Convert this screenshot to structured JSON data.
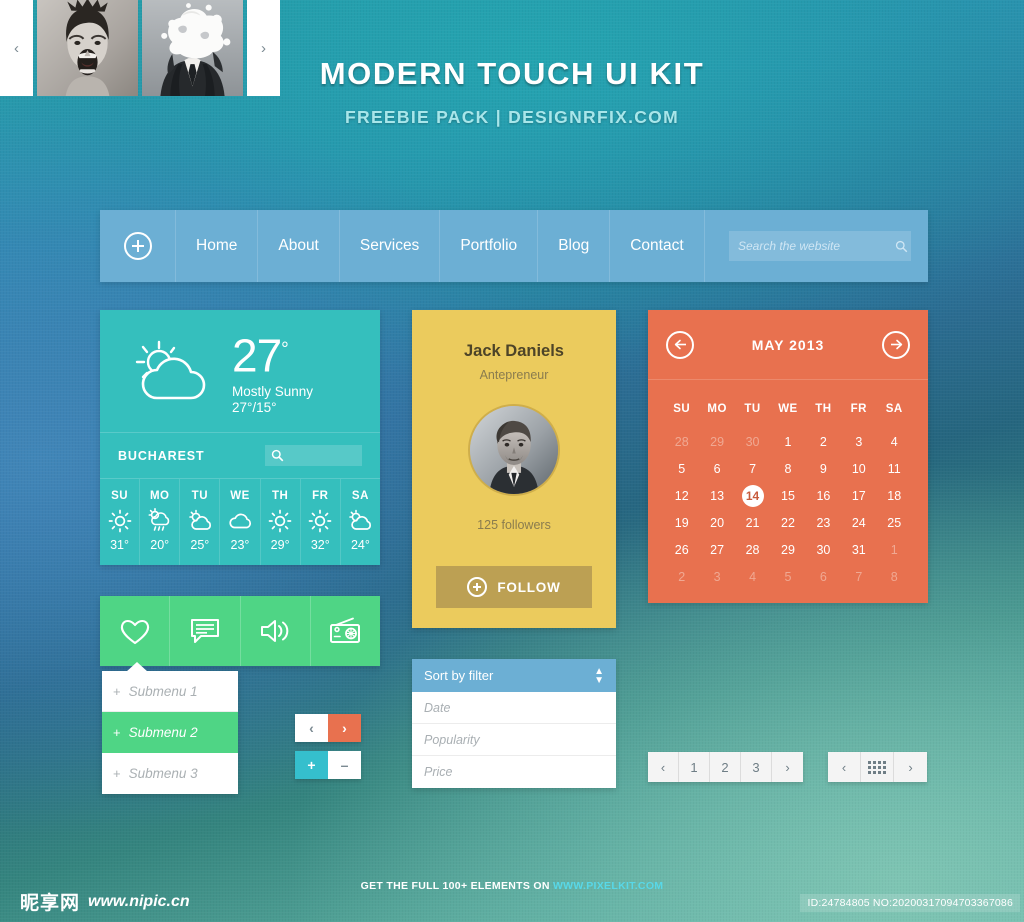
{
  "header": {
    "title": "MODERN TOUCH UI KIT",
    "subtitle": "FREEBIE PACK  |  DESIGNRFIX.COM"
  },
  "nav": {
    "items": [
      {
        "label": "Home"
      },
      {
        "label": "About"
      },
      {
        "label": "Services"
      },
      {
        "label": "Portfolio"
      },
      {
        "label": "Blog"
      },
      {
        "label": "Contact"
      }
    ],
    "search_placeholder": "Search the website",
    "search_value": "",
    "plus_icon": "plus-circle-icon",
    "search_icon": "search-icon",
    "bg_color": "#6cafd4"
  },
  "weather": {
    "temperature": "27",
    "degree": "°",
    "condition": "Mostly Sunny",
    "range": "27°/15°",
    "city": "BUCHAREST",
    "city_search_icon": "search-icon",
    "main_icon": "sun-behind-cloud-icon",
    "bg_color": "#35bfbd",
    "days": [
      {
        "day": "SU",
        "icon": "sun-icon",
        "temp": "31°"
      },
      {
        "day": "MO",
        "icon": "rain-cloud-icon",
        "temp": "20°"
      },
      {
        "day": "TU",
        "icon": "sun-behind-cloud-icon",
        "temp": "25°"
      },
      {
        "day": "WE",
        "icon": "cloud-icon",
        "temp": "23°"
      },
      {
        "day": "TH",
        "icon": "sun-icon",
        "temp": "29°"
      },
      {
        "day": "FR",
        "icon": "sun-icon",
        "temp": "32°"
      },
      {
        "day": "SA",
        "icon": "sun-behind-cloud-icon",
        "temp": "24°"
      }
    ]
  },
  "iconbar": {
    "bg_color": "#4fd585",
    "icons": [
      {
        "name": "heart-icon"
      },
      {
        "name": "chat-bubble-icon"
      },
      {
        "name": "speaker-icon"
      },
      {
        "name": "radio-icon"
      }
    ]
  },
  "submenu": {
    "items": [
      {
        "plus": "+",
        "label": "Submenu 1",
        "active": false
      },
      {
        "plus": "+",
        "label": "Submenu 2",
        "active": true
      },
      {
        "plus": "+",
        "label": "Submenu 3",
        "active": false
      }
    ]
  },
  "arrow_buttons": {
    "prev": "‹",
    "next": "›"
  },
  "stepper_buttons": {
    "plus": "+",
    "minus": "–"
  },
  "profile": {
    "name": "Jack Daniels",
    "role": "Antepreneur",
    "followers": "125 followers",
    "follow_label": "FOLLOW",
    "follow_icon": "plus-circle-icon",
    "avatar_icon": "avatar-photo",
    "bg_color": "#ebcb5d",
    "button_color": "#bca053"
  },
  "sort": {
    "header_label": "Sort by filter",
    "caret_icon": "updown-caret-icon",
    "options": [
      {
        "label": "Date"
      },
      {
        "label": "Popularity"
      },
      {
        "label": "Price"
      }
    ]
  },
  "calendar": {
    "title": "MAY 2013",
    "prev_icon": "arrow-left-circle-icon",
    "next_icon": "arrow-right-circle-icon",
    "bg_color": "#e8714f",
    "dow": [
      "SU",
      "MO",
      "TU",
      "WE",
      "TH",
      "FR",
      "SA"
    ],
    "selected": "14",
    "weeks": [
      [
        {
          "d": "28",
          "dim": true
        },
        {
          "d": "29",
          "dim": true
        },
        {
          "d": "30",
          "dim": true
        },
        {
          "d": "1"
        },
        {
          "d": "2"
        },
        {
          "d": "3"
        },
        {
          "d": "4"
        }
      ],
      [
        {
          "d": "5"
        },
        {
          "d": "6"
        },
        {
          "d": "7"
        },
        {
          "d": "8"
        },
        {
          "d": "9"
        },
        {
          "d": "10"
        },
        {
          "d": "11"
        }
      ],
      [
        {
          "d": "12"
        },
        {
          "d": "13"
        },
        {
          "d": "14",
          "sel": true
        },
        {
          "d": "15"
        },
        {
          "d": "16"
        },
        {
          "d": "17"
        },
        {
          "d": "18"
        }
      ],
      [
        {
          "d": "19"
        },
        {
          "d": "20"
        },
        {
          "d": "21"
        },
        {
          "d": "22"
        },
        {
          "d": "23"
        },
        {
          "d": "24"
        },
        {
          "d": "25"
        }
      ],
      [
        {
          "d": "26"
        },
        {
          "d": "27"
        },
        {
          "d": "28"
        },
        {
          "d": "29"
        },
        {
          "d": "30"
        },
        {
          "d": "31"
        },
        {
          "d": "1",
          "dim": true
        }
      ],
      [
        {
          "d": "2",
          "dim": true
        },
        {
          "d": "3",
          "dim": true
        },
        {
          "d": "4",
          "dim": true
        },
        {
          "d": "5",
          "dim": true
        },
        {
          "d": "6",
          "dim": true
        },
        {
          "d": "7",
          "dim": true
        },
        {
          "d": "8",
          "dim": true
        }
      ]
    ]
  },
  "carousel": {
    "prev": "‹",
    "next": "›",
    "slides": [
      {
        "name": "screaming-man-photo"
      },
      {
        "name": "exploding-head-suit-photo"
      }
    ]
  },
  "pagination": {
    "prev": "‹",
    "next": "›",
    "pages": [
      {
        "label": "1"
      },
      {
        "label": "2"
      },
      {
        "label": "3"
      }
    ]
  },
  "viewtoggle": {
    "prev": "‹",
    "next": "›",
    "grid_icon": "grid-view-icon"
  },
  "footer": {
    "text_before": "GET THE FULL 100+ ELEMENTS ON",
    "link": "WWW.PIXELKIT.COM",
    "watermark_cn": "昵享网",
    "watermark_url": "www.nipic.cn",
    "id_badge": "ID:24784805 NO:20200317094703367086"
  }
}
